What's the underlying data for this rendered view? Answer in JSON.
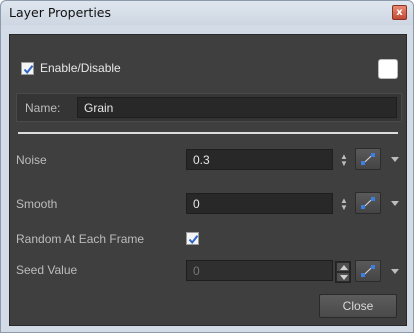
{
  "window": {
    "title": "Layer Properties",
    "close_glyph": "x"
  },
  "enable": {
    "label": "Enable/Disable",
    "checked": true
  },
  "name": {
    "label": "Name:",
    "value": "Grain"
  },
  "noise": {
    "label": "Noise",
    "value": "0.3"
  },
  "smooth": {
    "label": "Smooth",
    "value": "0"
  },
  "random": {
    "label": "Random At Each Frame",
    "checked": true
  },
  "seed": {
    "label": "Seed Value",
    "placeholder": "0"
  },
  "buttons": {
    "close": "Close"
  },
  "icons": {
    "check": "checkmark-icon",
    "function": "function-curve-icon",
    "spin": "spin-arrows-icon",
    "dropdown": "chevron-down-icon"
  },
  "colors": {
    "panel": "#3f3f3f",
    "accent_blue": "#3c7fe0",
    "check_blue": "#2f64c6"
  }
}
